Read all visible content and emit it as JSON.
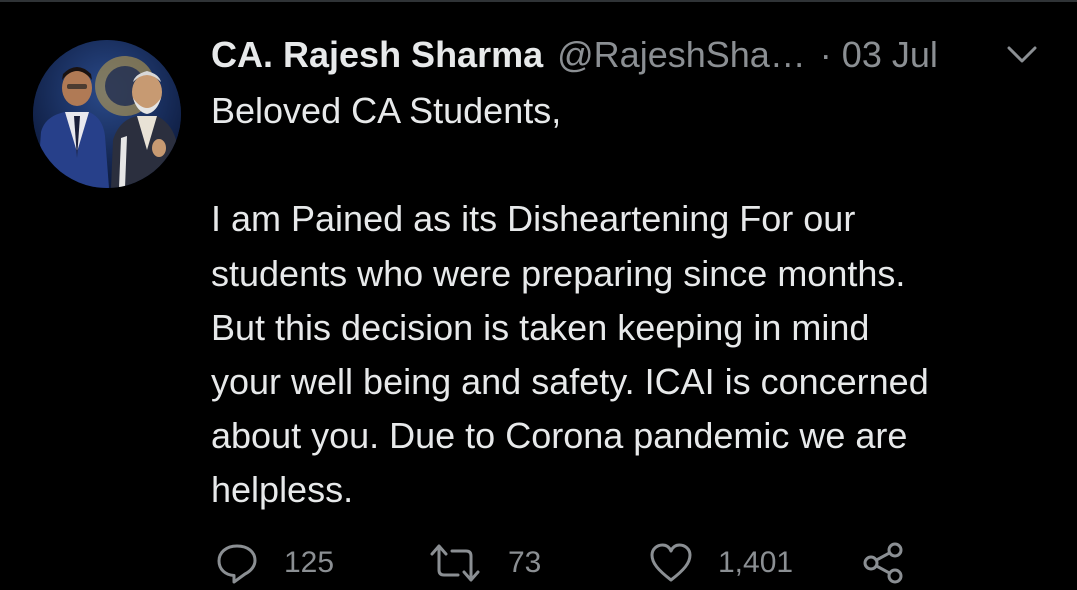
{
  "tweet": {
    "author": {
      "display_name": "CA. Rajesh Sharma",
      "handle": "@RajeshSha…",
      "avatar_icon": "profile-photo"
    },
    "separator": "·",
    "date": "03 Jul",
    "menu_icon": "chevron-down-icon",
    "body": {
      "greeting": "Beloved CA Students,",
      "lines": [
        "I am Pained as its Disheartening For our",
        "students who were preparing since months.",
        "But this decision is taken keeping in mind",
        "your well being and safety. ICAI is concerned",
        "about you. Due to Corona pandemic we are",
        "helpless."
      ]
    },
    "actions": {
      "reply_count": "125",
      "retweet_count": "73",
      "like_count": "1,401"
    }
  },
  "colors": {
    "background": "#000000",
    "text_primary": "#e7e9ea",
    "text_secondary": "#8b8f93"
  }
}
